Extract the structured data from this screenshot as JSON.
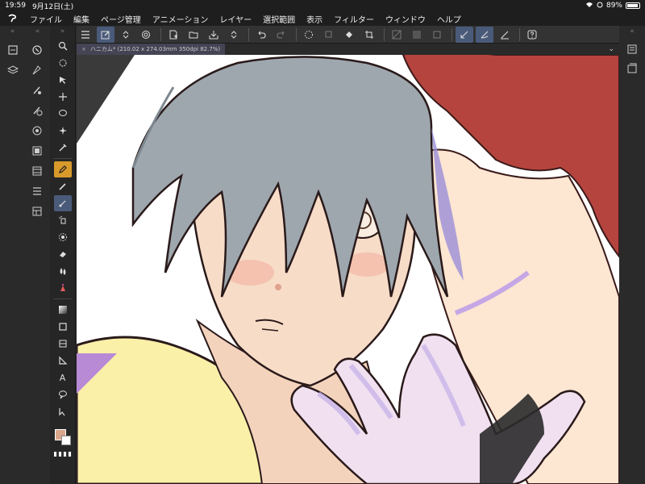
{
  "status": {
    "time": "19:59",
    "date": "9月12日(土)",
    "battery": "89%"
  },
  "menu": [
    "ファイル",
    "編集",
    "ページ管理",
    "アニメーション",
    "レイヤー",
    "選択範囲",
    "表示",
    "フィルター",
    "ウィンドウ",
    "ヘルプ"
  ],
  "document": {
    "tab_title": "ハニカム* (210.02 x 274.03mm 350dpi 82.7%)"
  },
  "tools": {
    "text_tool_glyph": "A"
  },
  "colors": {
    "main": "#d9a58a",
    "sub": "#ffffff",
    "active_tool": "#d79a2b",
    "selected": "#4a5b7a"
  }
}
